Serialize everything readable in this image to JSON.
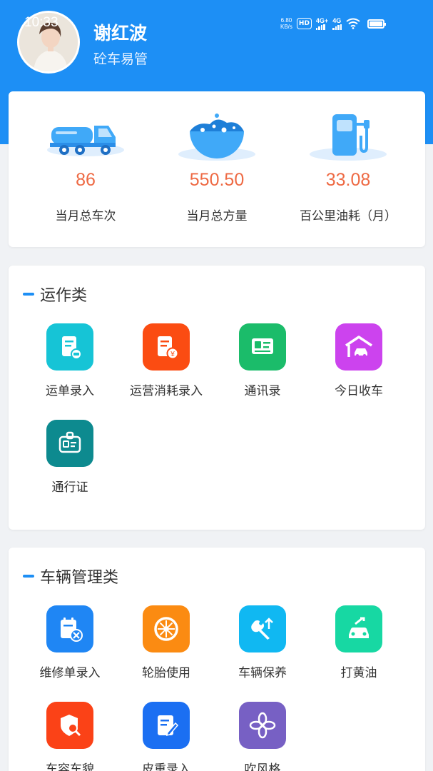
{
  "status_bar": {
    "time": "10:33",
    "net_speed": "6.80",
    "net_unit": "KB/s",
    "hd": "HD",
    "sim1": "4G+",
    "sim2": "4G"
  },
  "header": {
    "username": "谢红波",
    "app_name": "砼车易管"
  },
  "stats": [
    {
      "value": "86",
      "label": "当月总车次",
      "icon": "concrete-mixer-truck"
    },
    {
      "value": "550.50",
      "label": "当月总方量",
      "icon": "concrete-bowl"
    },
    {
      "value": "33.08",
      "label": "百公里油耗（月）",
      "icon": "fuel-pump"
    }
  ],
  "sections": {
    "ops": {
      "title": "运作类",
      "items": [
        {
          "label": "运单录入",
          "icon": "waybill-icon",
          "color": "#16c4d6"
        },
        {
          "label": "运营消耗录入",
          "icon": "expense-icon",
          "color": "#fb4c12"
        },
        {
          "label": "通讯录",
          "icon": "contacts-icon",
          "color": "#1bbc6a"
        },
        {
          "label": "今日收车",
          "icon": "garage-car-icon",
          "color": "#cc43ee"
        },
        {
          "label": "通行证",
          "icon": "pass-badge-icon",
          "color": "#0d8a8f"
        }
      ]
    },
    "vehicle": {
      "title": "车辆管理类",
      "items": [
        {
          "label": "维修单录入",
          "icon": "repair-order-icon",
          "color": "#1f86f4"
        },
        {
          "label": "轮胎使用",
          "icon": "tire-icon",
          "color": "#fb8b12"
        },
        {
          "label": "车辆保养",
          "icon": "wrench-icon",
          "color": "#10b8f2"
        },
        {
          "label": "打黄油",
          "icon": "car-wrench-icon",
          "color": "#17d8a3"
        },
        {
          "label": "车容车貌",
          "icon": "shield-search-icon",
          "color": "#fb4217"
        },
        {
          "label": "皮重录入",
          "icon": "tare-edit-icon",
          "color": "#1b6ff2"
        },
        {
          "label": "吹风格",
          "icon": "fan-icon",
          "color": "#7760c4"
        }
      ]
    }
  }
}
